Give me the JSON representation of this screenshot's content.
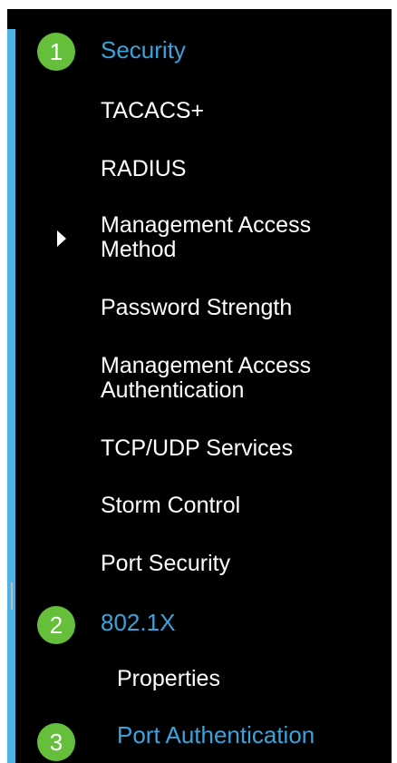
{
  "colors": {
    "accent": "#4db2e4",
    "active_text": "#3ba3dc",
    "step_badge": "#65bf3a",
    "item_text": "#ffffff",
    "panel_bg": "#000000"
  },
  "nav": {
    "security": {
      "label": "Security",
      "step": "1"
    },
    "items": [
      {
        "label": "TACACS+"
      },
      {
        "label": "RADIUS"
      },
      {
        "label": "Management Access\nMethod",
        "icon": "caret-right-icon"
      },
      {
        "label": "Password Strength"
      },
      {
        "label": "Management Access\nAuthentication"
      },
      {
        "label": "TCP/UDP Services"
      },
      {
        "label": "Storm Control"
      },
      {
        "label": "Port Security"
      }
    ],
    "dot1x": {
      "label": "802.1X",
      "step": "2"
    },
    "dot1x_items": [
      {
        "label": "Properties"
      }
    ],
    "port_auth": {
      "label": "Port Authentication",
      "step": "3"
    }
  }
}
